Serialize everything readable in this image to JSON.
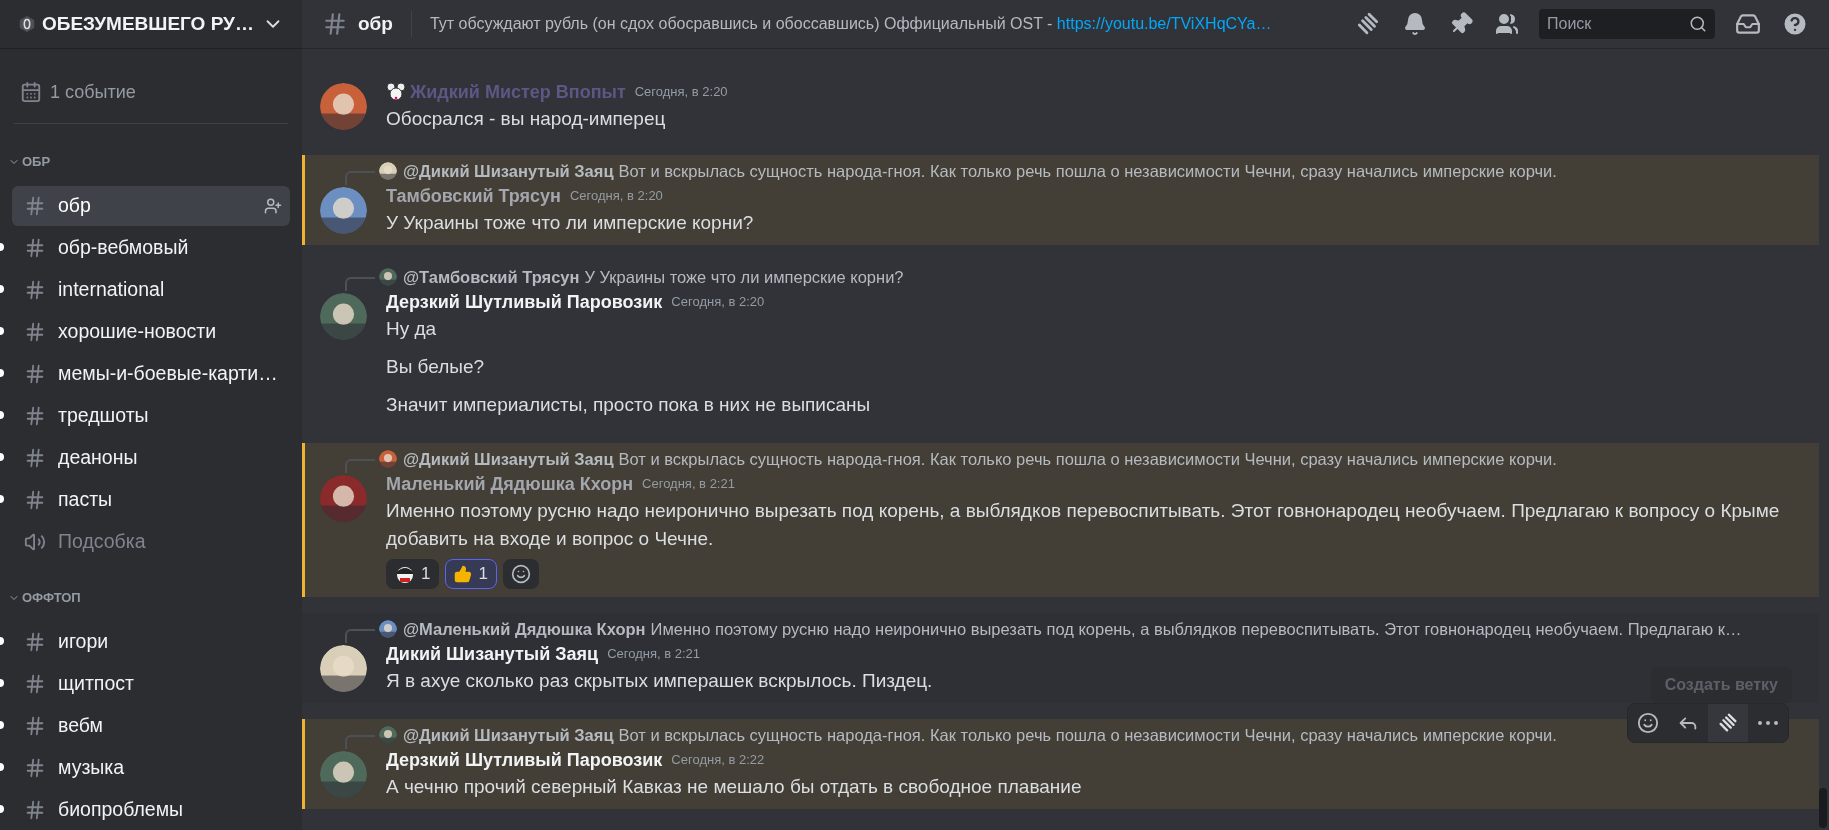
{
  "server": {
    "name": "ОБЕЗУМЕВШЕГО РУ…"
  },
  "events": {
    "label": "1 событие"
  },
  "categories": [
    {
      "name": "ОБР",
      "expanded": true,
      "channels": [
        {
          "name": "обр",
          "kind": "text",
          "selected": true,
          "unread": false
        },
        {
          "name": "обр-вебмовый",
          "kind": "text",
          "selected": false,
          "unread": true
        },
        {
          "name": "international",
          "kind": "text",
          "selected": false,
          "unread": true
        },
        {
          "name": "хорошие-новости",
          "kind": "text",
          "selected": false,
          "unread": true
        },
        {
          "name": "мемы-и-боевые-карти…",
          "kind": "text",
          "selected": false,
          "unread": true
        },
        {
          "name": "тредшоты",
          "kind": "text",
          "selected": false,
          "unread": true
        },
        {
          "name": "деаноны",
          "kind": "text",
          "selected": false,
          "unread": true
        },
        {
          "name": "пасты",
          "kind": "text",
          "selected": false,
          "unread": true
        },
        {
          "name": "Подсобка",
          "kind": "voice",
          "selected": false,
          "unread": false
        }
      ]
    },
    {
      "name": "ОФФТОП",
      "expanded": true,
      "channels": [
        {
          "name": "игори",
          "kind": "text",
          "selected": false,
          "unread": true
        },
        {
          "name": "щитпост",
          "kind": "text",
          "selected": false,
          "unread": true
        },
        {
          "name": "вебм",
          "kind": "text",
          "selected": false,
          "unread": true
        },
        {
          "name": "музыка",
          "kind": "text",
          "selected": false,
          "unread": true
        },
        {
          "name": "биопроблемы",
          "kind": "text",
          "selected": false,
          "unread": true
        }
      ]
    }
  ],
  "header": {
    "channel": "обр",
    "topic": "Тут обсуждают рубль (он сдох обосравшись и обоссавшись) Оффициальный OST - ",
    "link": "https://youtu.be/TViXHqCYa…",
    "search": {
      "placeholder": "Поиск"
    }
  },
  "messages": [
    {
      "author": "Жидкий Мистер Впопыт",
      "color": "#5c5785",
      "role_icon": true,
      "time": "Сегодня, в 2:20",
      "lines": [
        "Обосрался - вы народ-имперец"
      ],
      "mentioned": false,
      "hovered": false
    },
    {
      "reply": {
        "author": "@Дикий Шизанутый Заяц",
        "text": "Вот и вскрылась сущность народа-гноя. Как только речь пошла о независимости Чечни, сразу начались имперские корчи."
      },
      "author": "Тамбовский Трясун",
      "color": "#a3a6ad",
      "time": "Сегодня, в 2:20",
      "lines": [
        "У Украины тоже что ли имперские корни?"
      ],
      "mentioned": true,
      "hovered": false
    },
    {
      "reply": {
        "author": "@Тамбовский Трясун",
        "text": "У Украины тоже что ли имперские корни?"
      },
      "author": "Дерзкий Шутливый Паровозик",
      "color": "#f2f3f5",
      "time": "Сегодня, в 2:20",
      "lines": [
        "Ну да",
        "Вы белые?",
        "Значит империалисты, просто пока в них не выписаны"
      ],
      "mentioned": false,
      "hovered": false
    },
    {
      "reply": {
        "author": "@Дикий Шизанутый Заяц",
        "text": "Вот и вскрылась сущность народа-гноя. Как только речь пошла о независимости Чечни, сразу начались имперские корчи."
      },
      "author": "Маленький Дядюшка Кхорн",
      "color": "#a3a6ad",
      "time": "Сегодня, в 2:21",
      "lines": [
        "Именно поэтому русню надо неиронично вырезать под корень, а выблядков перевоспитывать. Этот говнонародец необучаем. Предлагаю к вопросу о Крыме добавить на входе и вопрос о Чечне."
      ],
      "mentioned": true,
      "hovered": false,
      "reactions": [
        {
          "kind": "custom",
          "count": "1",
          "selected": false
        },
        {
          "kind": "thumbs_up",
          "count": "1",
          "selected": true
        }
      ]
    },
    {
      "reply": {
        "author": "@Маленький Дядюшка Кхорн",
        "text": "Именно поэтому русню надо неиронично вырезать под корень, а выблядков перевоспитывать. Этот говнонародец необучаем. Предлагаю к…"
      },
      "author": "Дикий Шизанутый Заяц",
      "color": "#f2f3f5",
      "time": "Сегодня, в 2:21",
      "lines": [
        "Я в ахуе сколько раз скрытых имперашек вскрылось. Пиздец."
      ],
      "mentioned": false,
      "hovered": true
    },
    {
      "reply": {
        "author": "@Дикий Шизанутый Заяц",
        "text": "Вот и вскрылась сущность народа-гноя. Как только речь пошла о независимости Чечни, сразу начались имперские корчи."
      },
      "author": "Дерзкий Шутливый Паровозик",
      "color": "#f2f3f5",
      "time": "Сегодня, в 2:22",
      "lines": [
        "А чечню прочий северный Кавказ не мешало бы отдать в свободное плавание"
      ],
      "mentioned": true,
      "hovered": false
    }
  ],
  "tooltip": {
    "text": "Создать ветку"
  }
}
